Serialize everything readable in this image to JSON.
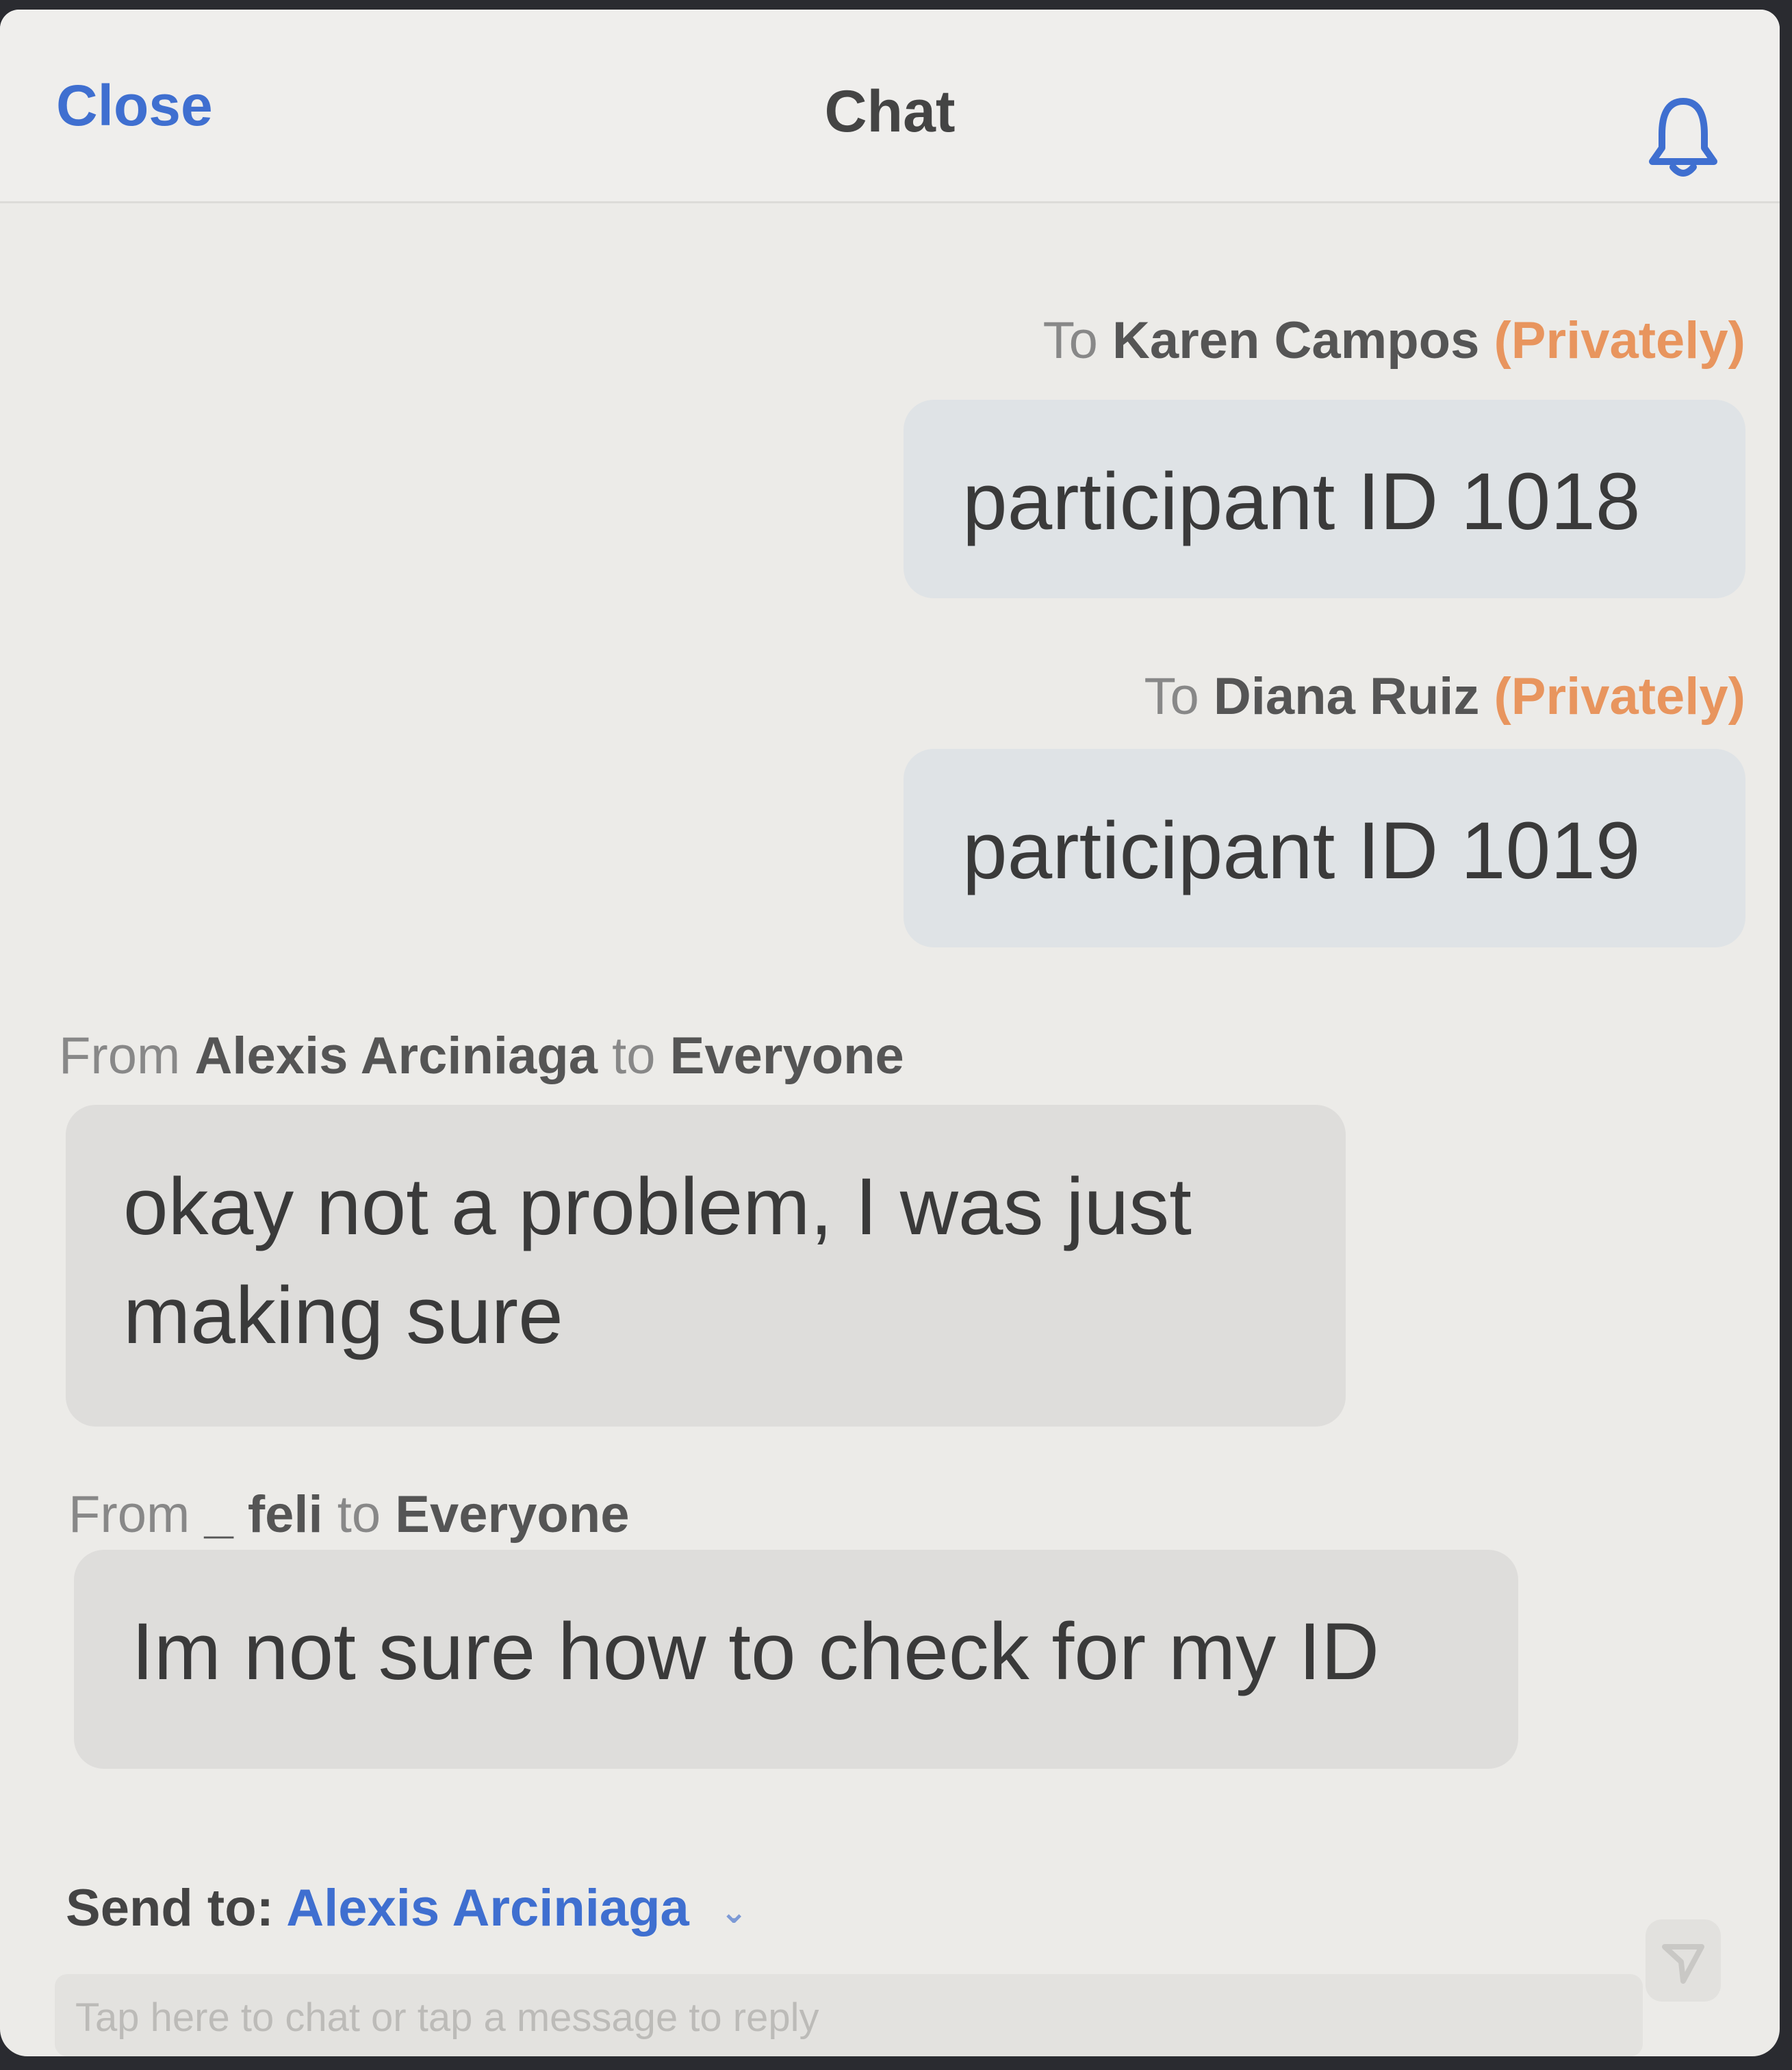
{
  "header": {
    "close_label": "Close",
    "title": "Chat",
    "bell_icon": "bell-icon"
  },
  "messages": [
    {
      "prefix": "To",
      "name": "Karen Campos",
      "privacy": "(Privately)",
      "text": "participant ID 1018"
    },
    {
      "prefix": "To",
      "name": "Diana Ruiz",
      "privacy": "(Privately)",
      "text": "participant ID 1019"
    },
    {
      "prefix": "From",
      "name": "Alexis Arciniaga",
      "connector": "to",
      "target": "Everyone",
      "text": "okay not a problem, I was just making sure"
    },
    {
      "prefix": "From",
      "name": "_ feli",
      "connector": "to",
      "target": "Everyone",
      "text": "Im not sure how to check for my ID"
    }
  ],
  "composer": {
    "send_to_label": "Send to:",
    "recipient": "Alexis Arciniaga",
    "placeholder": "Tap here to chat or tap a message to reply",
    "chevron_icon": "chevron-down-icon",
    "send_icon": "send-icon"
  },
  "colors": {
    "accent": "#3f6fd0",
    "private": "#e8955e",
    "outgoing_bubble": "#dfe3e6",
    "incoming_bubble": "#dedddb"
  }
}
